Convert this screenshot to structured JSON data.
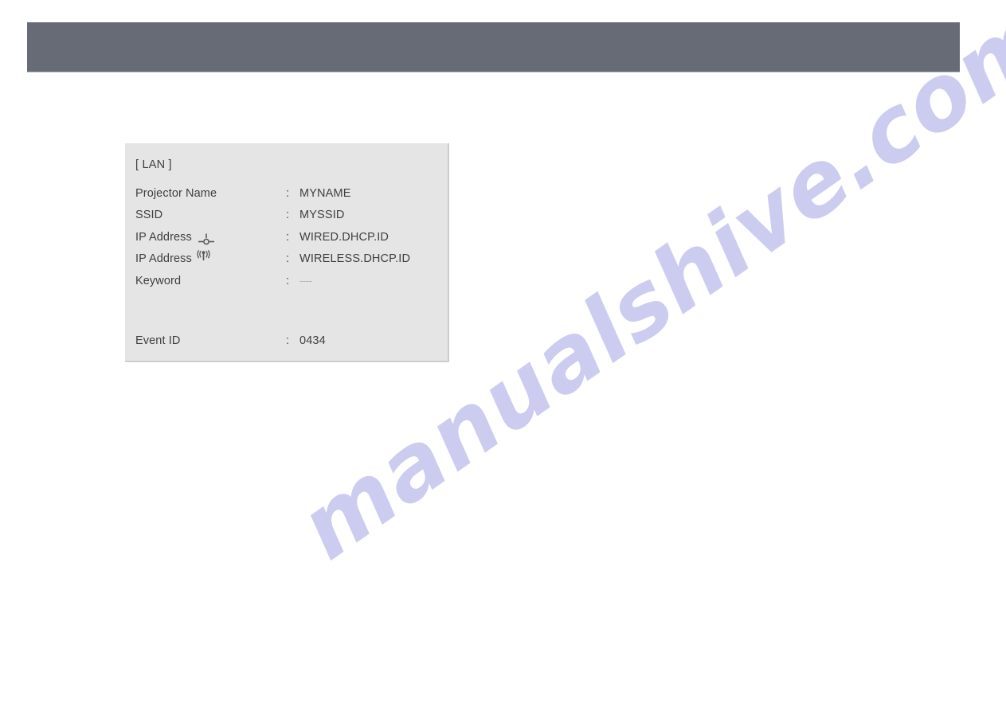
{
  "page": {
    "background_color": "#ffffff",
    "header_bar_color": "#676b75",
    "panel_background_color": "#e5e5e5",
    "text_color": "#3f3f3f",
    "watermark_color": "#ccccf0"
  },
  "watermark": {
    "text": "manualshive.com"
  },
  "lan_panel": {
    "section_title": "[ LAN ]",
    "colon": ":",
    "rows": [
      {
        "label": "Projector Name",
        "icon": null,
        "value": "MYNAME",
        "masked": false
      },
      {
        "label": "SSID",
        "icon": null,
        "value": "MYSSID",
        "masked": false
      },
      {
        "label": "IP Address",
        "icon": "wired-lan-icon",
        "value": "WIRED.DHCP.ID",
        "masked": false
      },
      {
        "label": "IP Address",
        "icon": "wireless-lan-icon",
        "value": "WIRELESS.DHCP.ID",
        "masked": false
      },
      {
        "label": "Keyword",
        "icon": null,
        "value": "----",
        "masked": true
      }
    ],
    "event": {
      "label": "Event ID",
      "colon": ":",
      "value": "0434"
    }
  }
}
